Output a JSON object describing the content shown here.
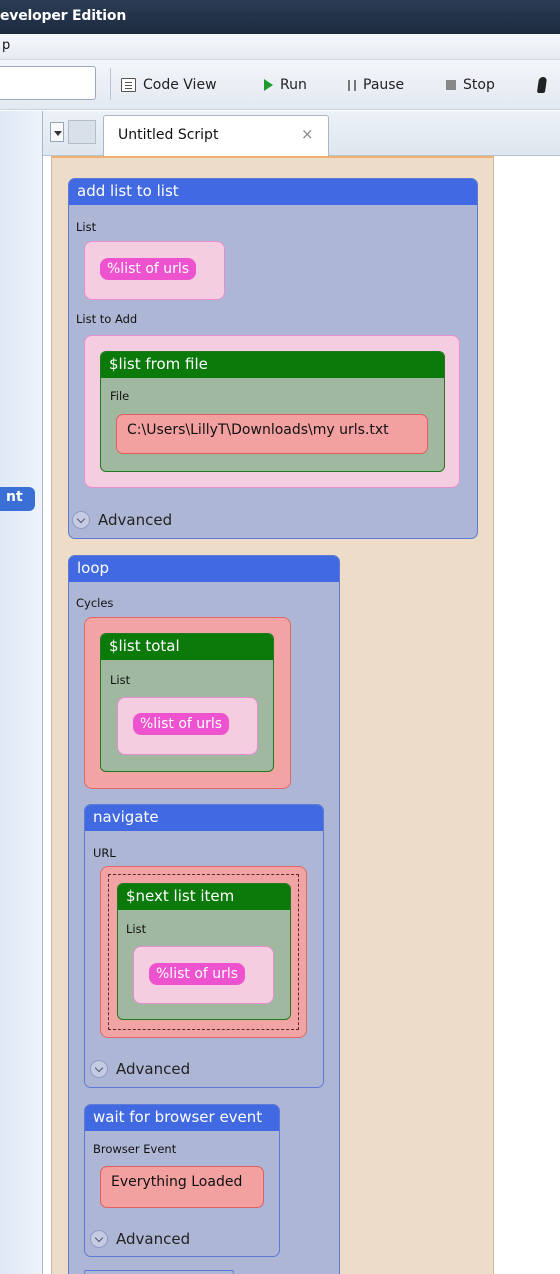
{
  "window": {
    "title": "eveloper Edition"
  },
  "menubar": {
    "visible_item": "p"
  },
  "toolbar": {
    "code_view_label": "Code View",
    "run_label": "Run",
    "pause_label": "Pause",
    "stop_label": "Stop"
  },
  "left_panel": {
    "badge_text": "nt"
  },
  "tabs": [
    {
      "label": "Untitled Script",
      "close": "×"
    }
  ],
  "script": {
    "add_list_to_list": {
      "title": "add list to list",
      "list_label": "List",
      "list_value": "%list of urls",
      "list_to_add_label": "List to Add",
      "list_from_file": {
        "title": "$list from file",
        "file_label": "File",
        "file_value": "C:\\Users\\LillyT\\Downloads\\my urls.txt"
      },
      "advanced_label": "Advanced"
    },
    "loop": {
      "title": "loop",
      "cycles_label": "Cycles",
      "list_total": {
        "title": "$list total",
        "list_label": "List",
        "list_value": "%list of urls"
      },
      "navigate": {
        "title": "navigate",
        "url_label": "URL",
        "next_list_item": {
          "title": "$next list item",
          "list_label": "List",
          "list_value": "%list of urls"
        },
        "advanced_label": "Advanced"
      },
      "wait_for_browser_event": {
        "title": "wait for browser event",
        "event_label": "Browser Event",
        "event_value": "Everything Loaded",
        "advanced_label": "Advanced"
      }
    }
  }
}
